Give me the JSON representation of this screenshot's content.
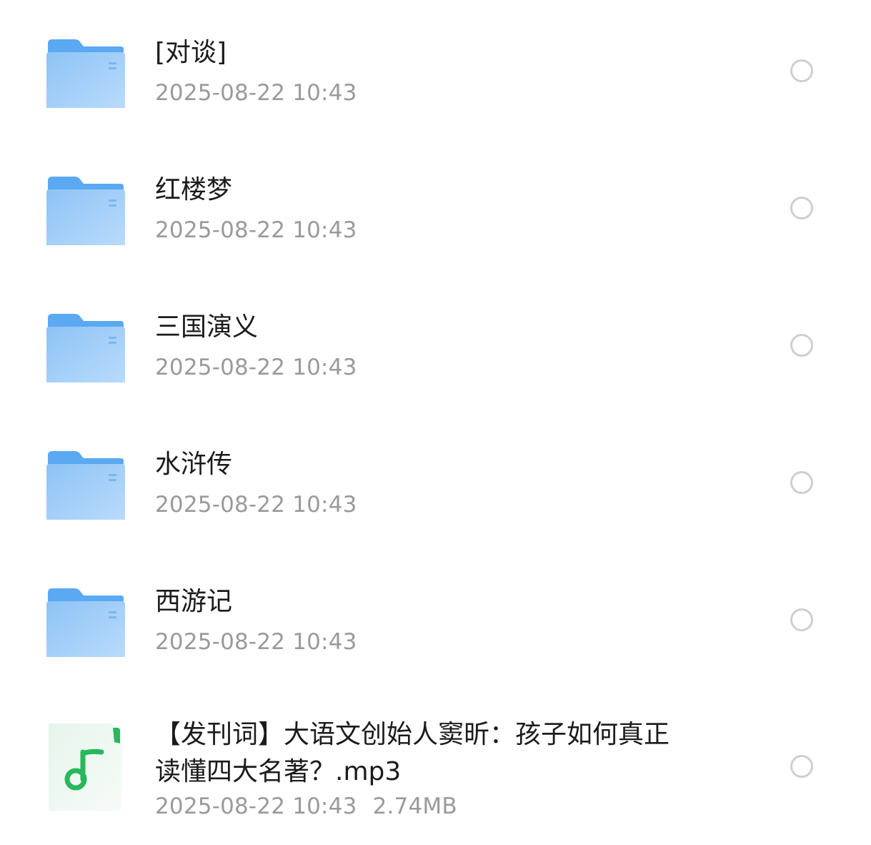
{
  "items": [
    {
      "name": "[对谈]",
      "date": "2025-08-22 10:43",
      "icon": "folder-icon"
    },
    {
      "name": "红楼梦",
      "date": "2025-08-22 10:43",
      "icon": "folder-icon"
    },
    {
      "name": "三国演义",
      "date": "2025-08-22 10:43",
      "icon": "folder-icon"
    },
    {
      "name": "水浒传",
      "date": "2025-08-22 10:43",
      "icon": "folder-icon"
    },
    {
      "name": "西游记",
      "date": "2025-08-22 10:43",
      "icon": "folder-icon"
    }
  ],
  "audio_file": {
    "name_line1": "【发刊词】大语文创始人窦昕：孩子如何真正",
    "name_line2": "读懂四大名著？.mp3",
    "date": "2025-08-22 10:43",
    "size": "2.74MB",
    "icon": "music-note-icon"
  },
  "colors": {
    "folder_back": "#5aa9f2",
    "folder_front": "#8fc4f7",
    "audio_green": "#27b85c",
    "date_gray": "#9a9a9a",
    "select_ring": "#cfcfcf"
  }
}
